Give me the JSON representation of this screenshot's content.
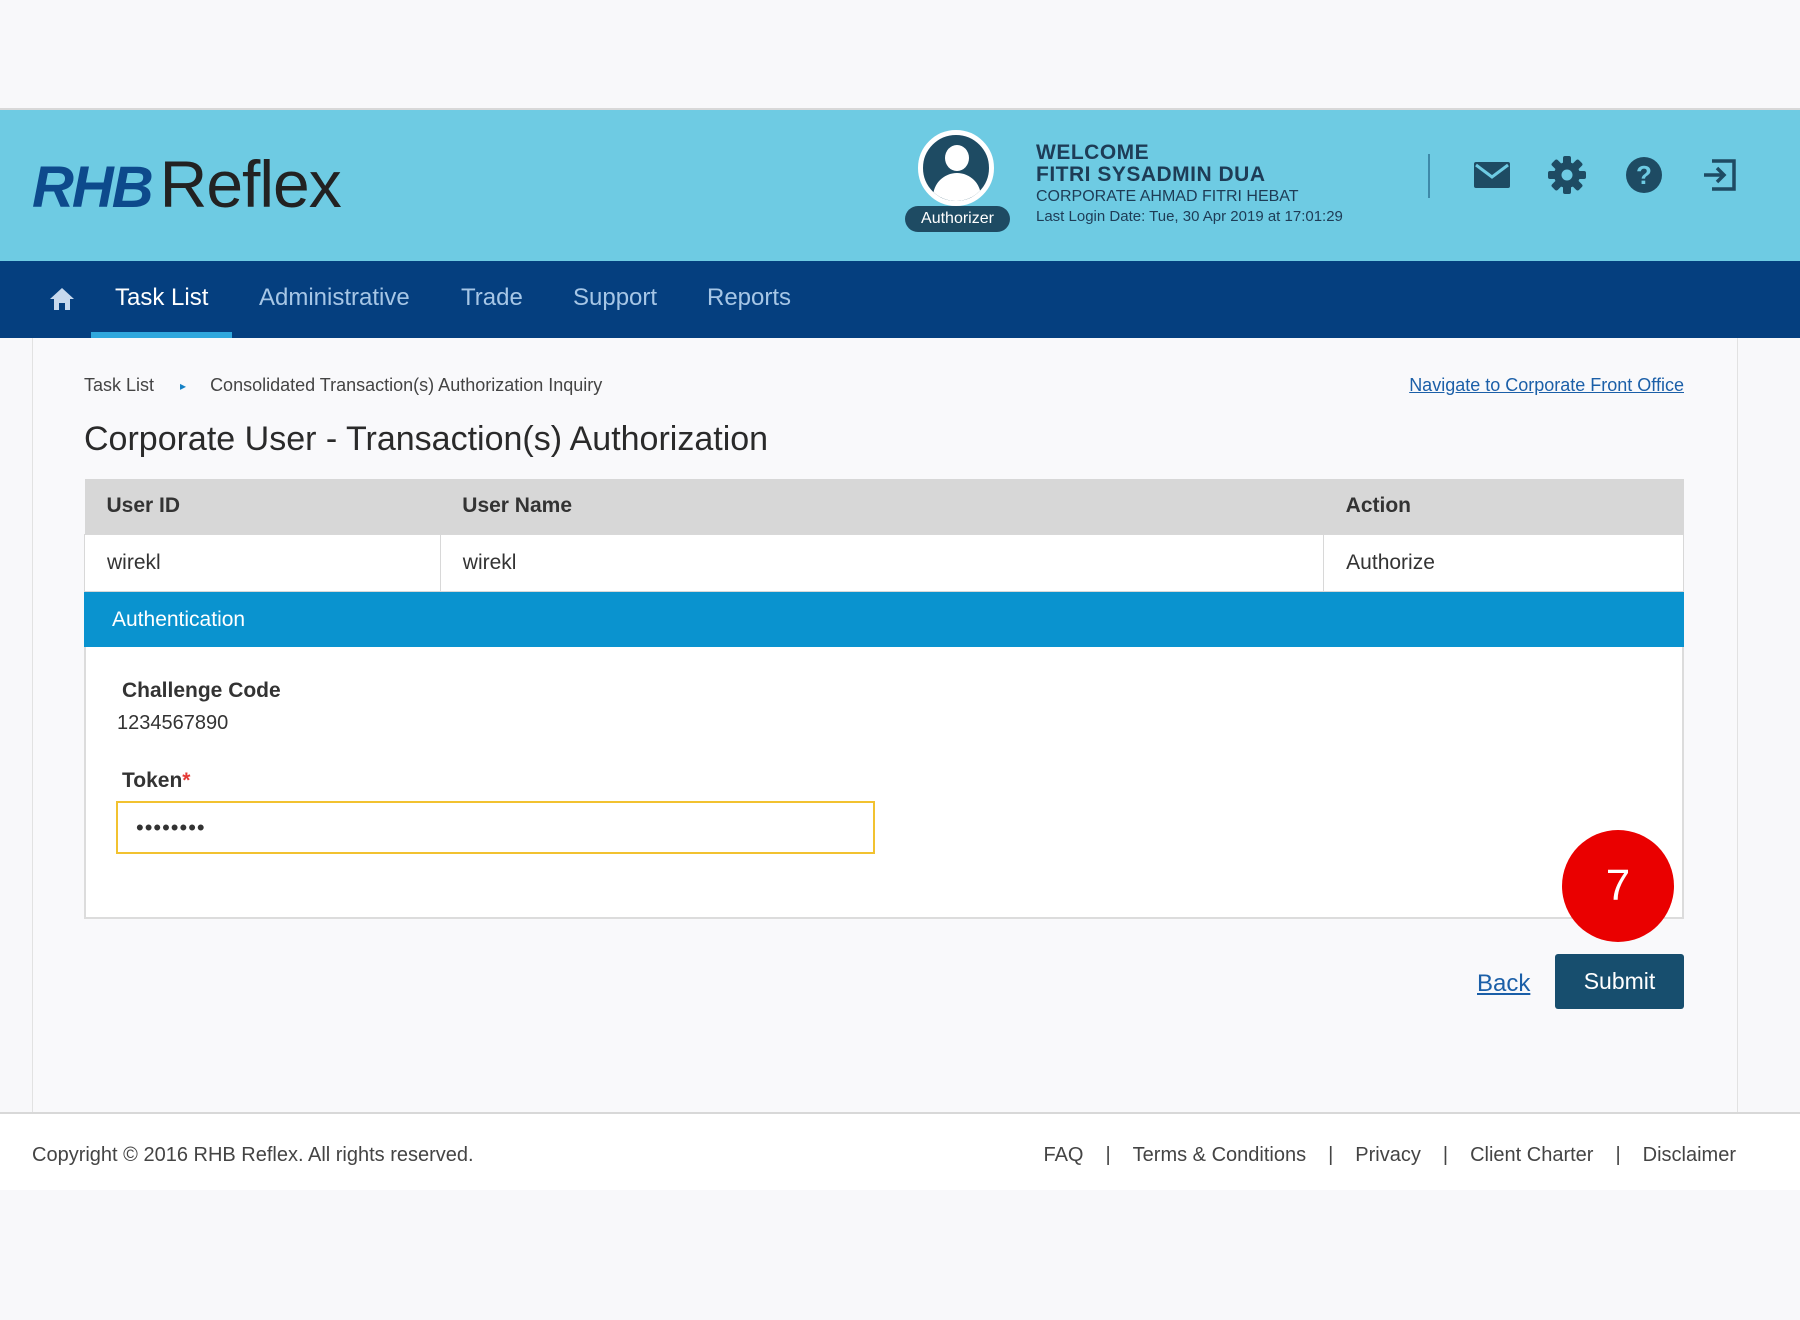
{
  "brand": {
    "part1": "RHB",
    "part2": "Reflex"
  },
  "user": {
    "role_badge": "Authorizer",
    "welcome": "WELCOME",
    "name": "FITRI SYSADMIN DUA",
    "company": "CORPORATE AHMAD FITRI HEBAT",
    "last_login": "Last Login Date: Tue, 30 Apr 2019 at 17:01:29"
  },
  "header_icons": [
    "mail-icon",
    "gear-icon",
    "help-icon",
    "logout-icon"
  ],
  "nav": {
    "home_icon": "home-icon",
    "tabs": [
      {
        "label": "Task List",
        "active": true
      },
      {
        "label": "Administrative"
      },
      {
        "label": "Trade"
      },
      {
        "label": "Support"
      },
      {
        "label": "Reports"
      }
    ]
  },
  "breadcrumb": {
    "items": [
      "Task List",
      "Consolidated Transaction(s) Authorization Inquiry"
    ],
    "separator": "▸"
  },
  "front_office_link": "Navigate to Corporate Front Office",
  "page_title": "Corporate User - Transaction(s) Authorization",
  "table": {
    "headers": [
      "User ID",
      "User Name",
      "Action"
    ],
    "rows": [
      [
        "wirekl",
        "wirekl",
        "Authorize"
      ]
    ]
  },
  "auth": {
    "section_title": "Authentication",
    "challenge_label": "Challenge Code",
    "challenge_value": "1234567890",
    "token_label": "Token",
    "required_mark": "*",
    "token_value": "••••••••"
  },
  "step_marker": "7",
  "actions": {
    "back": "Back",
    "submit": "Submit"
  },
  "footer": {
    "copyright": "Copyright © 2016 RHB Reflex. All rights reserved.",
    "links": [
      "FAQ",
      "Terms & Conditions",
      "Privacy",
      "Client Charter",
      "Disclaimer"
    ],
    "separator": "|"
  },
  "colors": {
    "header_bg": "#6ecbe3",
    "nav_bg": "#053f7f",
    "auth_bar": "#0a93cf",
    "submit_bg": "#174e6e",
    "step_marker": "#ea0000"
  }
}
